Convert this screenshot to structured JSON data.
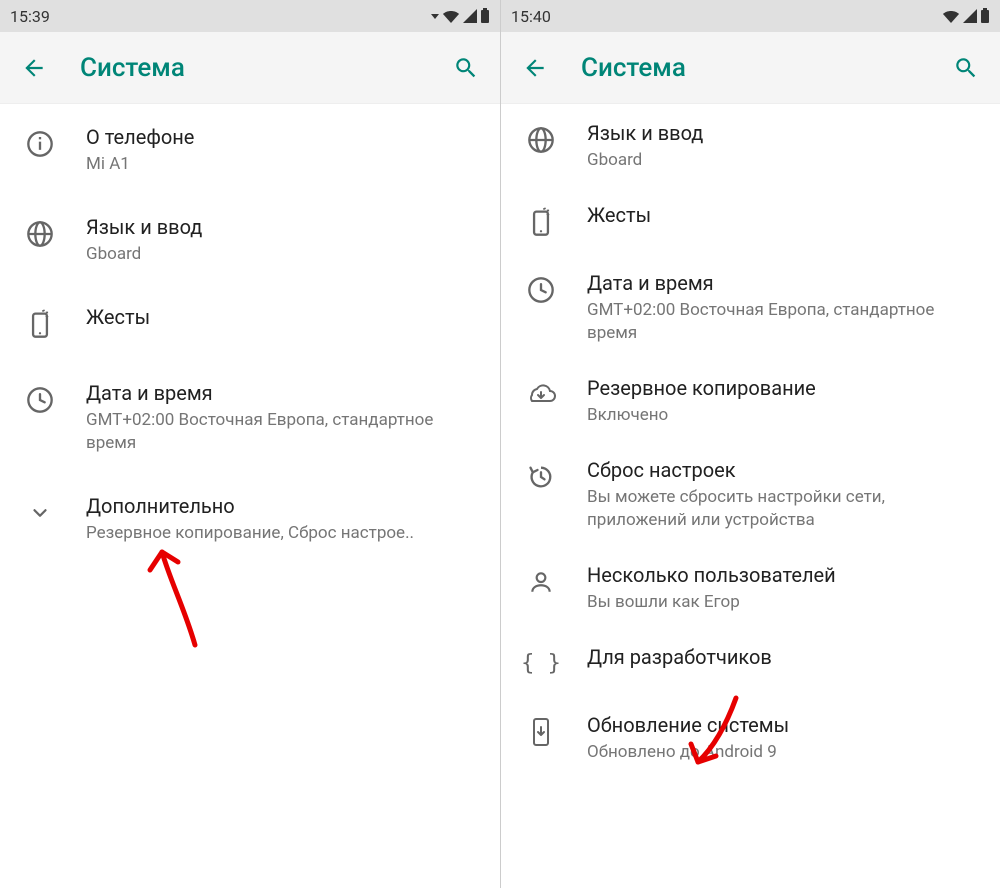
{
  "left": {
    "status_time": "15:39",
    "header_title": "Система",
    "items": [
      {
        "title": "О телефоне",
        "subtitle": "Mi A1"
      },
      {
        "title": "Язык и ввод",
        "subtitle": "Gboard"
      },
      {
        "title": "Жесты",
        "subtitle": ""
      },
      {
        "title": "Дата и время",
        "subtitle": "GMT+02:00 Восточная Европа, стандартное время"
      },
      {
        "title": "Дополнительно",
        "subtitle": "Резервное копирование, Сброс настрое.."
      }
    ]
  },
  "right": {
    "status_time": "15:40",
    "header_title": "Система",
    "items": [
      {
        "title": "Язык и ввод",
        "subtitle": "Gboard"
      },
      {
        "title": "Жесты",
        "subtitle": ""
      },
      {
        "title": "Дата и время",
        "subtitle": "GMT+02:00 Восточная Европа, стандартное время"
      },
      {
        "title": "Резервное копирование",
        "subtitle": "Включено"
      },
      {
        "title": "Сброс настроек",
        "subtitle": "Вы можете сбросить настройки сети, приложений или устройства"
      },
      {
        "title": "Несколько пользователей",
        "subtitle": "Вы вошли как Егор"
      },
      {
        "title": "Для разработчиков",
        "subtitle": ""
      },
      {
        "title": "Обновление системы",
        "subtitle": "Обновлено до Android 9"
      }
    ]
  }
}
